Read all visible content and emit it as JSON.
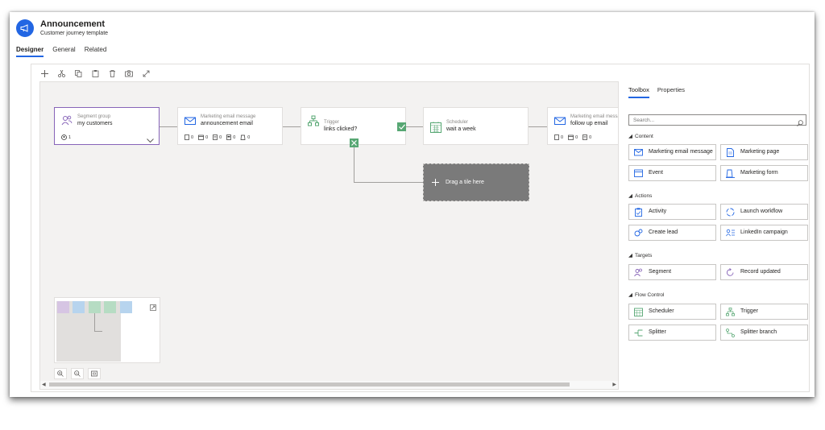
{
  "header": {
    "title": "Announcement",
    "subtitle": "Customer journey template"
  },
  "tabs": [
    {
      "label": "Designer",
      "active": true
    },
    {
      "label": "General",
      "active": false
    },
    {
      "label": "Related",
      "active": false
    }
  ],
  "toolbar": {
    "icons": [
      "add-icon",
      "cut-icon",
      "copy-icon",
      "paste-icon",
      "delete-icon",
      "screenshot-icon",
      "expand-icon"
    ]
  },
  "tiles": [
    {
      "type": "Segment group",
      "name": "my customers",
      "icon": "segment-icon",
      "stats": [
        "1"
      ]
    },
    {
      "type": "Marketing email message",
      "name": "announcement email",
      "icon": "email-icon",
      "stats": [
        "0",
        "0",
        "0",
        "0",
        "0"
      ]
    },
    {
      "type": "Trigger",
      "name": "links clicked?",
      "icon": "trigger-icon"
    },
    {
      "type": "Scheduler",
      "name": "wait a week",
      "icon": "scheduler-icon"
    },
    {
      "type": "Marketing email message",
      "name": "follow up email",
      "icon": "email-icon",
      "stats": [
        "0",
        "0",
        "0"
      ]
    }
  ],
  "drop_tile": {
    "label": "Drag a tile here"
  },
  "panel": {
    "tabs": [
      {
        "label": "Toolbox",
        "active": true
      },
      {
        "label": "Properties",
        "active": false
      }
    ],
    "search_placeholder": "Search...",
    "sections": [
      {
        "title": "Content",
        "items": [
          {
            "label": "Marketing email message",
            "icon": "email-icon"
          },
          {
            "label": "Marketing page",
            "icon": "page-icon"
          },
          {
            "label": "Event",
            "icon": "event-icon"
          },
          {
            "label": "Marketing form",
            "icon": "form-icon"
          }
        ]
      },
      {
        "title": "Actions",
        "items": [
          {
            "label": "Activity",
            "icon": "activity-icon"
          },
          {
            "label": "Launch workflow",
            "icon": "workflow-icon"
          },
          {
            "label": "Create lead",
            "icon": "lead-icon"
          },
          {
            "label": "LinkedIn campaign",
            "icon": "linkedin-icon"
          }
        ]
      },
      {
        "title": "Targets",
        "items": [
          {
            "label": "Segment",
            "icon": "segment-icon"
          },
          {
            "label": "Record updated",
            "icon": "record-updated-icon"
          }
        ]
      },
      {
        "title": "Flow Control",
        "items": [
          {
            "label": "Scheduler",
            "icon": "scheduler-icon"
          },
          {
            "label": "Trigger",
            "icon": "trigger-icon"
          },
          {
            "label": "Splitter",
            "icon": "splitter-icon"
          },
          {
            "label": "Splitter branch",
            "icon": "splitter-branch-icon"
          }
        ]
      }
    ]
  },
  "colors": {
    "accent": "#2266e3",
    "segment": "#8764b8",
    "flow": "#57a773"
  }
}
